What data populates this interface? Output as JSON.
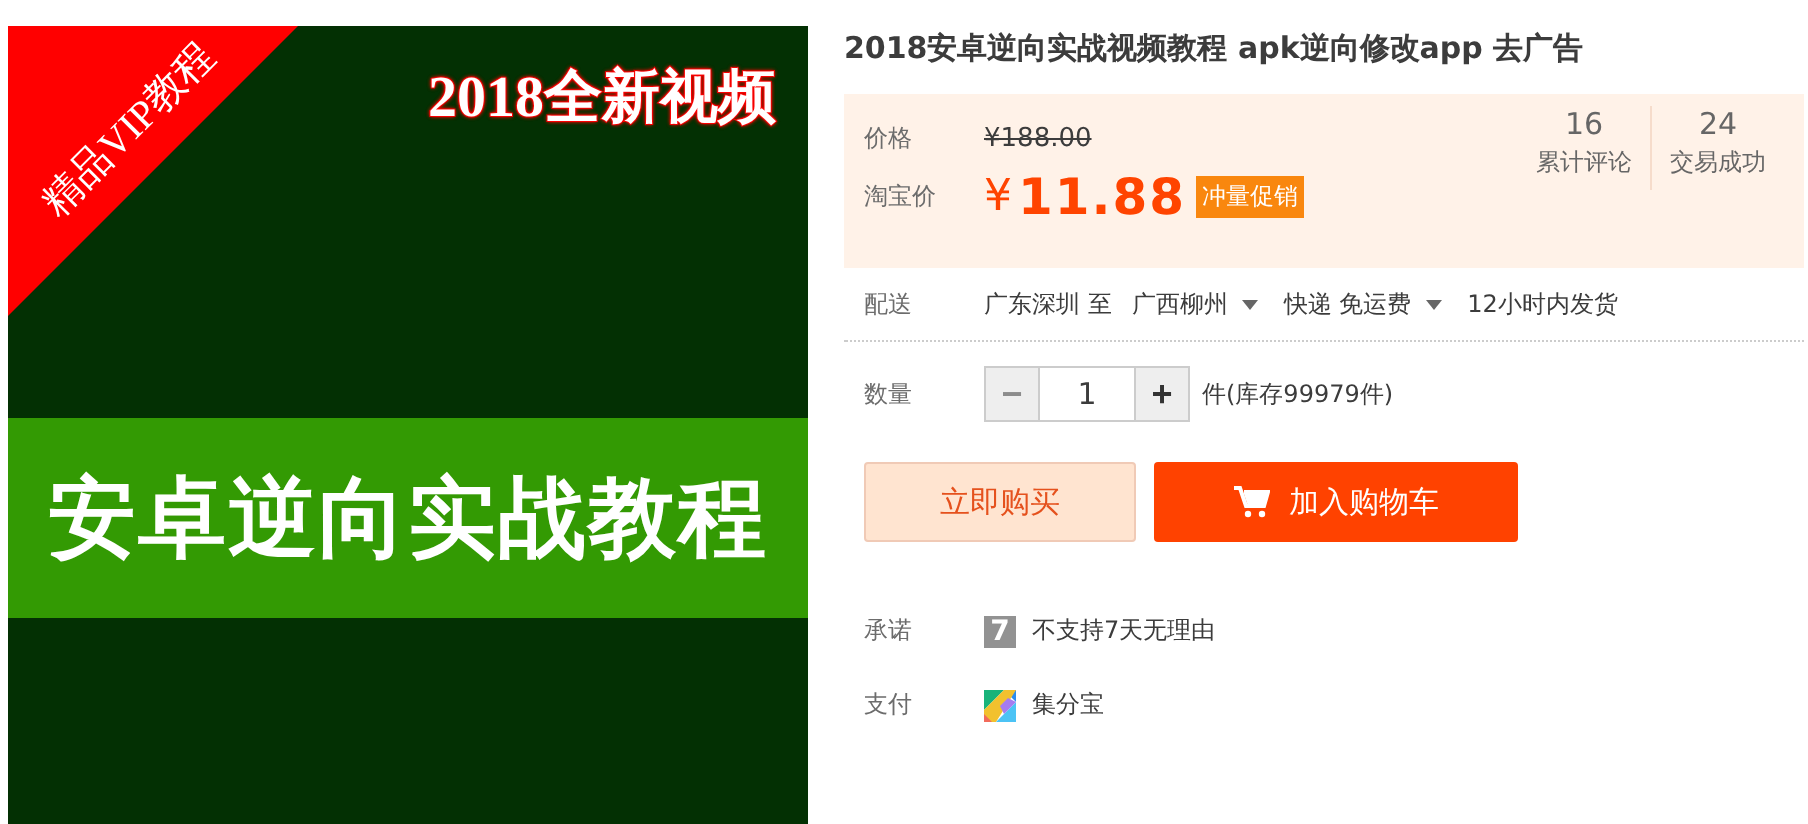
{
  "banner": {
    "corner_ribbon": "精品VIP教程",
    "headline": "2018全新视频",
    "band_text": "安卓逆向实战教程"
  },
  "title": "2018安卓逆向实战视频教程 apk逆向修改app 去广告",
  "price_box": {
    "original_label": "价格",
    "original_price": "¥188.00",
    "price_label": "淘宝价",
    "currency": "¥",
    "price": "11.88",
    "promo_tag": "冲量促销",
    "stats": [
      {
        "count": "16",
        "label": "累计评论"
      },
      {
        "count": "24",
        "label": "交易成功"
      }
    ]
  },
  "delivery": {
    "label": "配送",
    "from": "广东深圳 至",
    "to": "广西柳州",
    "method": "快递 免运费",
    "time": "12小时内发货"
  },
  "quantity": {
    "label": "数量",
    "minus": "−",
    "minus_disabled": true,
    "value": "1",
    "plus": "+",
    "stock": "件(库存99979件)"
  },
  "buttons": [
    {
      "kind": "buy",
      "label": "立即购买"
    },
    {
      "kind": "cart",
      "label": "加入购物车"
    }
  ],
  "services": [
    {
      "label": "承诺",
      "kind": "seven",
      "icon_text": "7",
      "text": "不支持7天无理由"
    },
    {
      "label": "支付",
      "kind": "pay",
      "text": "集分宝"
    }
  ]
}
